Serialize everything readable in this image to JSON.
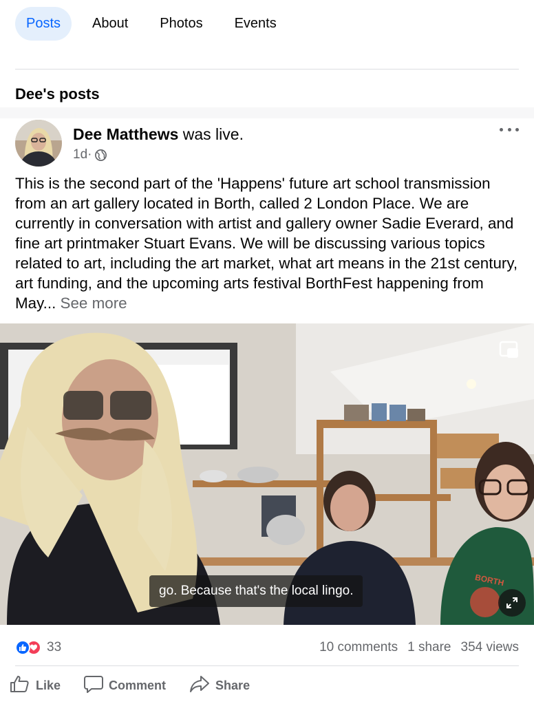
{
  "tabs": [
    {
      "label": "Posts",
      "active": true
    },
    {
      "label": "About",
      "active": false
    },
    {
      "label": "Photos",
      "active": false
    },
    {
      "label": "Events",
      "active": false
    }
  ],
  "section_title": "Dee's posts",
  "post": {
    "author": "Dee Matthews",
    "action": " was live.",
    "time": "1d",
    "separator": " · ",
    "privacy_icon": "globe-icon",
    "text": "This is the second part of the 'Happens' future art school transmission from an art gallery located in Borth, called 2 London Place. We are currently in conversation with artist and gallery owner Sadie Everard, and fine art printmaker Stuart Evans. We will be discussing various topics related to art, including the art market, what art means in the 21st century, art funding, and the upcoming arts festival BorthFest happening from May...",
    "see_more": " See more",
    "video": {
      "caption": "go. Because that's the local lingo.",
      "shirt_text": "BORTH"
    },
    "stats": {
      "reaction_count": "33",
      "comments": "10 comments",
      "shares": "1 share",
      "views": "354 views"
    },
    "actions": {
      "like": "Like",
      "comment": "Comment",
      "share": "Share"
    }
  },
  "colors": {
    "accent": "#0866ff",
    "active_tab_bg": "#e4effc",
    "love": "#f33e58",
    "secondary_text": "#65676b"
  }
}
